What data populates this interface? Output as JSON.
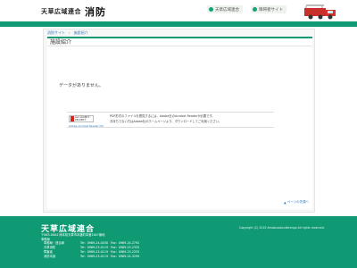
{
  "header": {
    "logo_small": "天草広域連合",
    "logo_big": "消防",
    "links": [
      {
        "label": "天草広域連合"
      },
      {
        "label": "障碍者サイト"
      }
    ]
  },
  "breadcrumb": [
    {
      "label": "消防サイト"
    },
    {
      "label": "施設紹介"
    }
  ],
  "page_title": "施設紹介",
  "no_data_text": "データがありません。",
  "adobe": {
    "badge_text": "Get ADOBE® READER®",
    "link_text": "Adobe Acrobat Reader DC",
    "notice_line1": "PDF形式のファイルを閲覧するには、Adobe社のAcrobat Readerが必要です。",
    "notice_line2": "お持ちでない方はAdobe社のホームページより、ダウンロードしてご利用ください。"
  },
  "page_top_label": "ページの先頭へ",
  "footer": {
    "title": "天草広域連合",
    "address": "〒863-0004 熊本県天草市本渡町本渡1847番地",
    "office": "事務局",
    "rows": [
      {
        "name": "事務局・連合局",
        "tel": "Tel：0969-24-0030",
        "fax": "Fax：0969-24-2792"
      },
      {
        "name": "天草消防",
        "tel": "Tel：0969-23-0119",
        "fax": "Fax：0969-23-2335"
      },
      {
        "name": "障害者",
        "tel": "Tel：0969-23-0119",
        "fax": "Fax：0969-23-2335"
      },
      {
        "name": "消防本部",
        "tel": "Tel：0969-23-0119",
        "fax": "Fax：0969-24-3299"
      }
    ],
    "copyright": "Copyright (C) 2019 Amakusakouikirengo All rights reserved."
  },
  "colors": {
    "brand_green": "#0f9a73",
    "link_blue": "#2c7bbf"
  }
}
